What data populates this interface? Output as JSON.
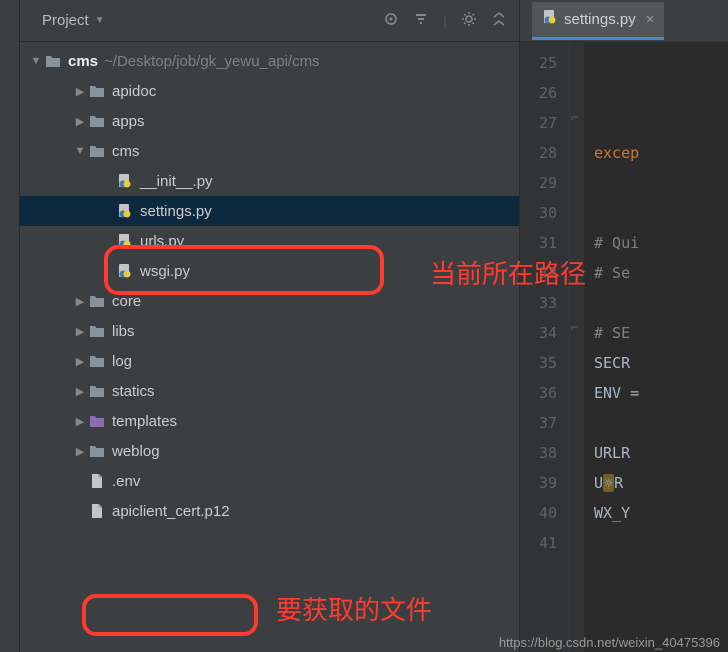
{
  "panel": {
    "title": "Project",
    "toolbar_icons": [
      "target-icon",
      "settings-icon",
      "gear-icon",
      "collapse-icon"
    ]
  },
  "tree": {
    "root": {
      "label": "cms",
      "path": "~/Desktop/job/gk_yewu_api/cms"
    },
    "items": [
      {
        "label": "apidoc",
        "type": "folder",
        "indent": 1,
        "arrow": "right"
      },
      {
        "label": "apps",
        "type": "folder",
        "indent": 1,
        "arrow": "right"
      },
      {
        "label": "cms",
        "type": "folder",
        "indent": 1,
        "arrow": "down"
      },
      {
        "label": "__init__.py",
        "type": "py",
        "indent": 2,
        "arrow": ""
      },
      {
        "label": "settings.py",
        "type": "py",
        "indent": 2,
        "arrow": "",
        "selected": true
      },
      {
        "label": "urls.py",
        "type": "py",
        "indent": 2,
        "arrow": ""
      },
      {
        "label": "wsgi.py",
        "type": "py",
        "indent": 2,
        "arrow": ""
      },
      {
        "label": "core",
        "type": "folder",
        "indent": 1,
        "arrow": "right"
      },
      {
        "label": "libs",
        "type": "folder",
        "indent": 1,
        "arrow": "right"
      },
      {
        "label": "log",
        "type": "folder",
        "indent": 1,
        "arrow": "right"
      },
      {
        "label": "statics",
        "type": "folder",
        "indent": 1,
        "arrow": "right"
      },
      {
        "label": "templates",
        "type": "folder-purple",
        "indent": 1,
        "arrow": "right"
      },
      {
        "label": "weblog",
        "type": "folder",
        "indent": 1,
        "arrow": "right"
      },
      {
        "label": ".env",
        "type": "file",
        "indent": 1,
        "arrow": ""
      },
      {
        "label": "apiclient_cert.p12",
        "type": "file",
        "indent": 1,
        "arrow": ""
      }
    ]
  },
  "editor": {
    "tab": {
      "label": "settings.py"
    },
    "lines": {
      "start": 25,
      "end": 41,
      "code": [
        {
          "n": 25,
          "t": ""
        },
        {
          "n": 26,
          "t": ""
        },
        {
          "n": 27,
          "t": ""
        },
        {
          "n": 28,
          "t": "kw",
          "c": "excep"
        },
        {
          "n": 29,
          "t": ""
        },
        {
          "n": 30,
          "t": ""
        },
        {
          "n": 31,
          "t": "cm",
          "c": "# Qui"
        },
        {
          "n": 32,
          "t": "cm",
          "c": "# Se"
        },
        {
          "n": 33,
          "t": ""
        },
        {
          "n": 34,
          "t": "cm",
          "c": "# SE"
        },
        {
          "n": 35,
          "t": "",
          "c": "SECR"
        },
        {
          "n": 36,
          "t": "",
          "c": "ENV ="
        },
        {
          "n": 37,
          "t": ""
        },
        {
          "n": 38,
          "t": "",
          "c": "URLR"
        },
        {
          "n": 39,
          "t": "warn",
          "c": "URLR"
        },
        {
          "n": 40,
          "t": "",
          "c": "WX_Y"
        },
        {
          "n": 41,
          "t": ""
        }
      ]
    }
  },
  "annotations": {
    "label1": "当前所在路径",
    "label2": "要获取的文件"
  },
  "watermark": "https://blog.csdn.net/weixin_40475396"
}
